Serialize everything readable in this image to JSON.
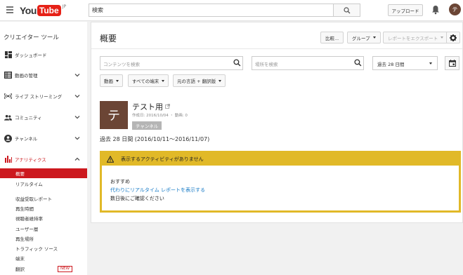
{
  "header": {
    "logo_you": "You",
    "logo_tube": "Tube",
    "logo_region": "JP",
    "search_value": "検索",
    "upload_label": "アップロード",
    "avatar_letter": "テ"
  },
  "sidebar": {
    "title": "クリエイター ツール",
    "items": [
      {
        "label": "ダッシュボード"
      },
      {
        "label": "動画の管理"
      },
      {
        "label": "ライブ ストリーミング"
      },
      {
        "label": "コミュニティ"
      },
      {
        "label": "チャンネル"
      },
      {
        "label": "アナリティクス"
      }
    ],
    "subitems": [
      {
        "label": "概要"
      },
      {
        "label": "リアルタイム"
      },
      {
        "label": "収益受取レポート"
      },
      {
        "label": "再生時間"
      },
      {
        "label": "視聴者維持率"
      },
      {
        "label": "ユーザー層"
      },
      {
        "label": "再生場所"
      },
      {
        "label": "トラフィック ソース"
      },
      {
        "label": "端末"
      },
      {
        "label": "翻訳"
      }
    ],
    "new_badge": "NEW"
  },
  "main": {
    "title": "概要",
    "compare_label": "比較...",
    "group_label": "グループ",
    "export_label": "レポートをエクスポート",
    "content_search_placeholder": "コンテンツを検索",
    "location_search_placeholder": "場所を検索",
    "date_range": "過去 28 日間",
    "filters": [
      "動画",
      "すべての端末",
      "元の言語 + 翻訳版"
    ],
    "channel": {
      "thumb_letter": "テ",
      "name": "テスト用",
      "meta": "作成日: 2016/10/04 ・ 動画: 0",
      "badge": "チャンネル"
    },
    "period": "過去 28 日間 (2016/10/11〜2016/11/07)",
    "alert": {
      "heading": "表示するアクティビティがありません",
      "rec_title": "おすすめ",
      "rec_link": "代わりにリアルタイム レポートを表示する",
      "rec_note": "数日後にご確認ください"
    }
  },
  "colors": {
    "brand_red": "#e62117",
    "accent_red": "#cc181e",
    "alert_yellow": "#e1b928",
    "link_blue": "#167ac6",
    "avatar_brown": "#6b4535"
  }
}
